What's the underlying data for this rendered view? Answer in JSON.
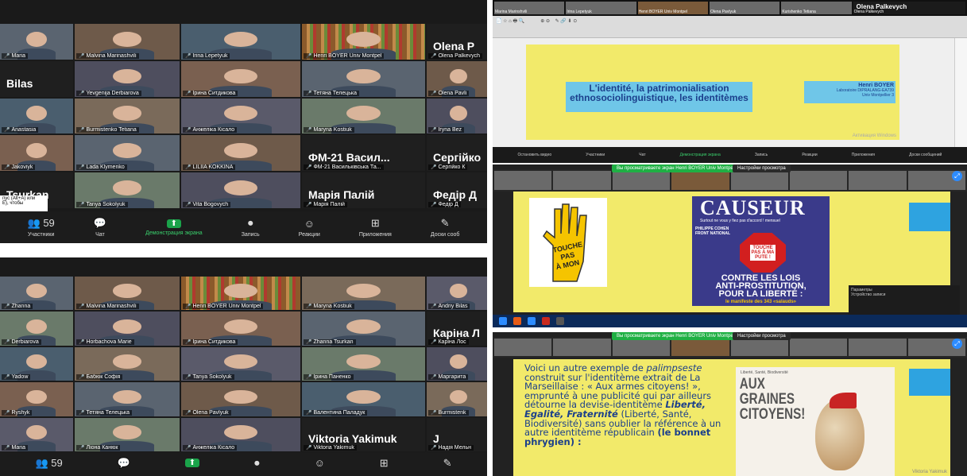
{
  "top_left": {
    "tiles": [
      {
        "name": "Maria",
        "active": false
      },
      {
        "name": "Malvina Marinashvili",
        "active": false
      },
      {
        "name": "Irina Lepetyuk",
        "active": false
      },
      {
        "name": "Henri BOYER Univ Montpel",
        "active": true,
        "shelf": true
      },
      {
        "name": "Olena Palkevych",
        "big": "Olena P"
      },
      {
        "name": "",
        "big": "Bilas"
      },
      {
        "name": "Yevgenija Derbiarova"
      },
      {
        "name": "Ірина Ситдикова"
      },
      {
        "name": "Тетяна Телецька"
      },
      {
        "name": "Olena Pavli"
      },
      {
        "name": "Anastasia"
      },
      {
        "name": "Burmistenko Tetiana"
      },
      {
        "name": "Анжеліка Кісало"
      },
      {
        "name": "Maryna Kostiuk"
      },
      {
        "name": "Iryna Bez"
      },
      {
        "name": "Jakoviyk"
      },
      {
        "name": "Lada Klymenko"
      },
      {
        "name": "LILIIA KOKKINA"
      },
      {
        "name": "ФМ-21 Васильківська Та...",
        "big": "ФМ-21 Васил..."
      },
      {
        "name": "Сергійко К",
        "big": "Сергійко"
      },
      {
        "name": "",
        "big": "Tsurkan"
      },
      {
        "name": "Tanya Sokolyuk"
      },
      {
        "name": "Vita Bogovych"
      },
      {
        "name": "Марія Палій",
        "big": "Марія Палій"
      },
      {
        "name": "Федір Д",
        "big": "Федір Д"
      }
    ],
    "toolbar": [
      {
        "icon": "👥",
        "count": "59",
        "label": "Участники"
      },
      {
        "icon": "💬",
        "count": "",
        "label": "Чат"
      },
      {
        "icon": "⬆",
        "count": "",
        "label": "Демонстрация экрана",
        "green": true
      },
      {
        "icon": "⏺",
        "count": "",
        "label": "Запись"
      },
      {
        "icon": "☺",
        "count": "",
        "label": "Реакции"
      },
      {
        "icon": "⊞",
        "count": "",
        "label": "Приложения"
      },
      {
        "icon": "✎",
        "count": "",
        "label": "Доски сооб"
      }
    ],
    "tooltip": "пус (Alt+A) или\nE), чтобы"
  },
  "bottom_left": {
    "tiles": [
      {
        "name": "Zhanna"
      },
      {
        "name": "Malvina Marinashvili"
      },
      {
        "name": "Henri BOYER Univ Montpel",
        "shelf": true
      },
      {
        "name": "Maryna Kostiuk"
      },
      {
        "name": "Andriy Bilas"
      },
      {
        "name": "Derbiarova"
      },
      {
        "name": "Horbachova Marie"
      },
      {
        "name": "Ірина Ситдикова"
      },
      {
        "name": "Zhanna Tsurkan"
      },
      {
        "name": "Каріна Лос",
        "big": "Каріна Л"
      },
      {
        "name": "Yadow"
      },
      {
        "name": "Бабюк Софія"
      },
      {
        "name": "Tanya Sokolyuk"
      },
      {
        "name": "Ірина Паненко"
      },
      {
        "name": "Маргарита"
      },
      {
        "name": "Ryshyk"
      },
      {
        "name": "Тетяна Телецька"
      },
      {
        "name": "Olena Pavlyuk"
      },
      {
        "name": "Валентина Паладук"
      },
      {
        "name": "Burmistenk"
      },
      {
        "name": "Maria"
      },
      {
        "name": "Ліона Канюк"
      },
      {
        "name": "Анжеліка Кісало"
      },
      {
        "name": "Viktoria Yakimuk",
        "big": "Viktoria Yakimuk"
      },
      {
        "name": "Надія Мельн",
        "big": "J"
      }
    ],
    "toolbar": [
      {
        "icon": "👥",
        "count": "59",
        "label": ""
      },
      {
        "icon": "💬",
        "count": "",
        "label": ""
      },
      {
        "icon": "⬆",
        "count": "",
        "label": "",
        "green": true
      },
      {
        "icon": "⏺",
        "count": "",
        "label": ""
      },
      {
        "icon": "☺",
        "count": "",
        "label": ""
      },
      {
        "icon": "⊞",
        "count": "",
        "label": ""
      },
      {
        "icon": "✎",
        "count": "",
        "label": ""
      }
    ]
  },
  "slide1": {
    "title": "L'identité, la patrimonialisation ethnosociolinguistique, les identitèmes",
    "author": "Henri BOYER",
    "author_sub": "Laboratoire DIPRALANG-EA739\nUniv Montpellier 3",
    "top_names": [
      "Marina Marinshvili",
      "Irina Lepetyuk",
      "Henri BOYER Univ Montpel",
      "Olena Pavlyuk",
      "Kurishenko Tetiana",
      "Olena Palkevych"
    ],
    "big_name": "Olena Palkevych",
    "activate": "Активация Windows",
    "toolbar": [
      "Остановить видео",
      "Участники",
      "Чат",
      "Демонстрация экрана",
      "Запись",
      "Реакции",
      "Приложения",
      "Доски сообщений"
    ]
  },
  "slide2": {
    "banner": "Вы просматриваете экран Henri BOYER Univ Montpellier3",
    "view_opt": "Настройки просмотра",
    "causeur": "CAUSEUR",
    "causeur_sub": "Surtout ne vous y fiez pas d'accord ! mensuel",
    "causeur_name": "PHILIPPE COHEN",
    "front": "FRONT NATIONAL",
    "hand_text": "TOUCHE PAS À MON POTE",
    "stop_text": "TOUCHE PAS À MA PUTE !",
    "bottom1": "CONTRE LES LOIS",
    "bottom2": "ANTI-PROSTITUTION,",
    "bottom3": "POUR LA LIBERTÉ :",
    "bottom4": "le manifeste des 343 «salauds»",
    "side_note": "Параметры\nУстройство записи"
  },
  "slide3": {
    "banner": "Вы просматриваете экран Henri BOYER Univ Montpellier3",
    "view_opt": "Настройки просмотра",
    "paragraph_parts": [
      {
        "t": "Voici un autre exemple de ",
        "s": "n"
      },
      {
        "t": "palimpseste",
        "s": "i"
      },
      {
        "t": " construit sur l'identitème extrait de La Marseillaise : « Aux armes citoyens! »,  emprunté à une publicité qui par ailleurs détourne la devise-identitème ",
        "s": "n"
      },
      {
        "t": "Liberté, Egalité, Fraternité",
        "s": "bi"
      },
      {
        "t": " (Liberté, Santé, Biodiversité) sans oublier la référence à un autre identitème républicain ",
        "s": "n"
      },
      {
        "t": "(le bonnet phrygien) :",
        "s": "b"
      }
    ],
    "poster_top": "Liberté, Santé, Biodiversité",
    "poster_title": "AUX GRAINES CITOYENS!",
    "corner": "Viktoria Yakimuk"
  }
}
